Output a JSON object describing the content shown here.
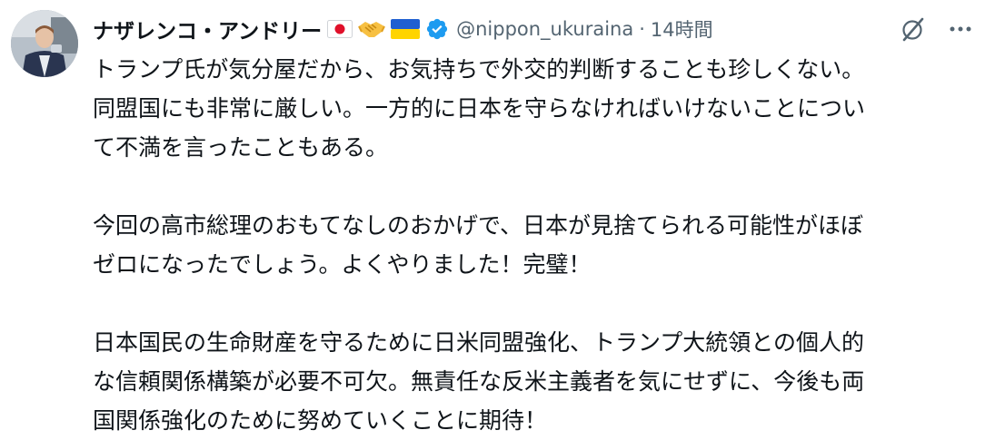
{
  "post": {
    "author_name": "ナザレンコ・アンドリー",
    "handle": "@nippon_ukuraina",
    "separator": "·",
    "time": "14時間",
    "verified_color": "#1d9bf0",
    "icons": {
      "flag_japan": "flag-japan-icon",
      "handshake": "handshake-icon",
      "flag_ukraine": "flag-ukraine-icon",
      "verified": "verified-badge-icon",
      "grok": "grok-icon",
      "more": "more-icon"
    },
    "lines": [
      "トランプ氏が気分屋だから、お気持ちで外交的判断することも珍しくない。",
      "同盟国にも非常に厳しい。一方的に日本を守らなければいけないことについ",
      "て不満を言ったこともある。",
      "今回の高市総理のおもてなしのおかげで、日本が見捨てられる可能性がほぼ",
      "ゼロになったでしょう。よくやりました！完璧！",
      "日本国民の生命財産を守るために日米同盟強化、トランプ大統領との個人的",
      "な信頼関係構築が必要不可欠。無責任な反米主義者を気にせずに、今後も両",
      "国関係強化のために努めていくことに期待！"
    ]
  }
}
